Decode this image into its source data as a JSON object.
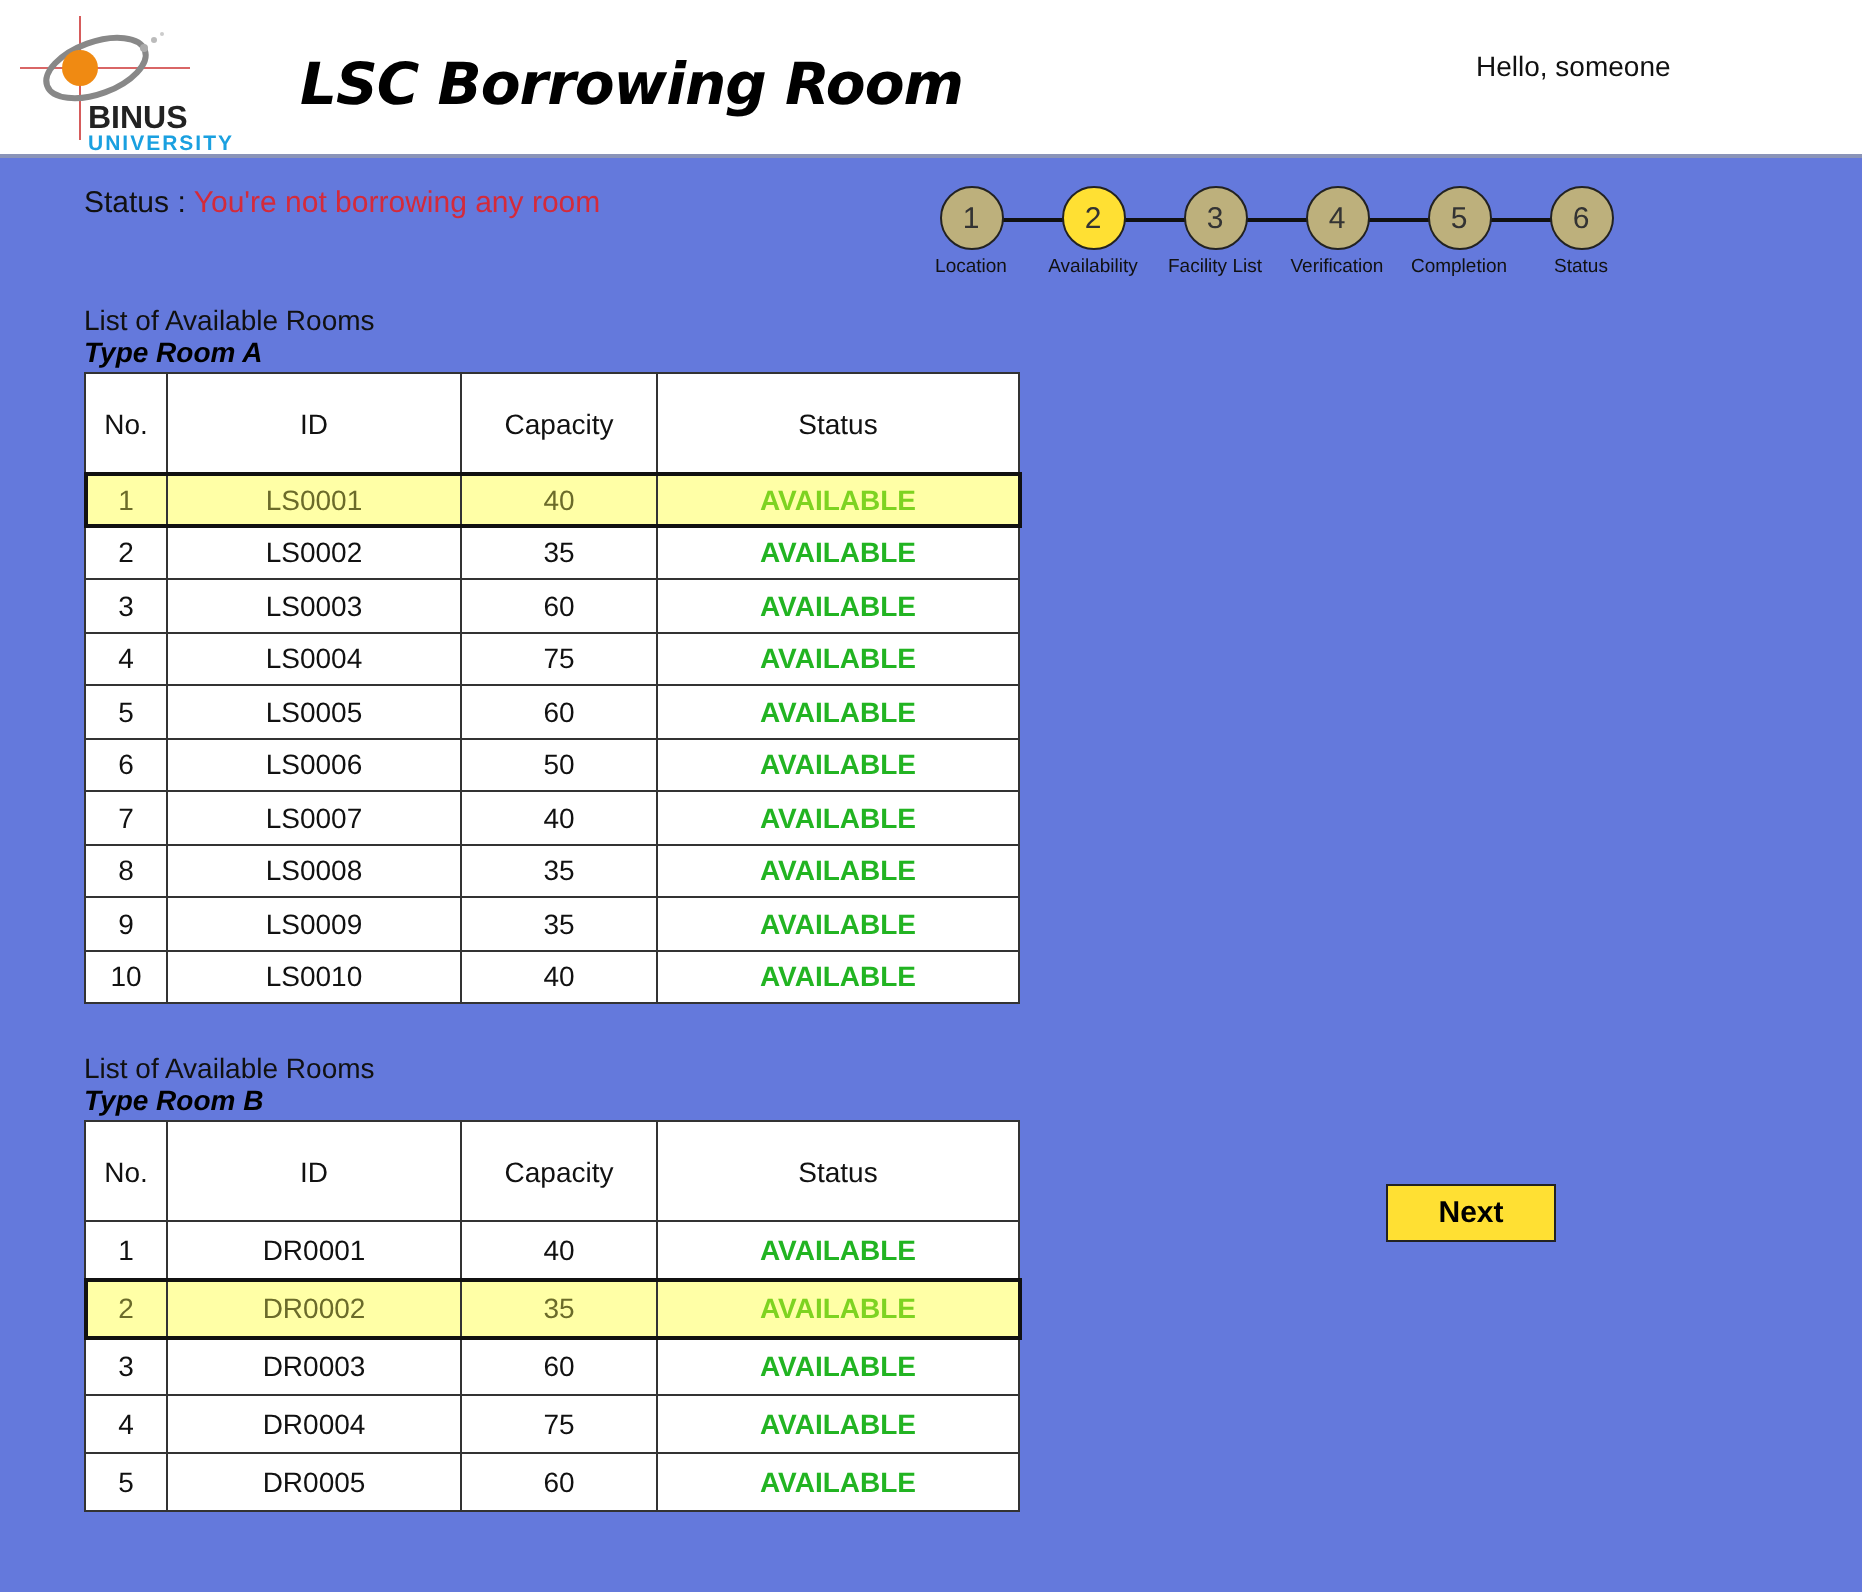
{
  "header": {
    "logo": {
      "name": "BINUS",
      "subtitle": "UNIVERSITY"
    },
    "title": "LSC Borrowing Room",
    "greeting": "Hello, someone"
  },
  "status": {
    "label": "Status :",
    "value": "You're not borrowing any room"
  },
  "steps": [
    {
      "number": "1",
      "label": "Location",
      "selected": false
    },
    {
      "number": "2",
      "label": "Availability",
      "selected": true
    },
    {
      "number": "3",
      "label": "Facility List",
      "selected": false
    },
    {
      "number": "4",
      "label": "Verification",
      "selected": false
    },
    {
      "number": "5",
      "label": "Completion",
      "selected": false
    },
    {
      "number": "6",
      "label": "Status",
      "selected": false
    }
  ],
  "tables": [
    {
      "heading": "List of Available Rooms",
      "type": "Type Room A",
      "columns": [
        "No.",
        "ID",
        "Capacity",
        "Status"
      ],
      "rows": [
        {
          "no": "1",
          "id": "LS0001",
          "capacity": "40",
          "status": "AVAILABLE",
          "selected": true
        },
        {
          "no": "2",
          "id": "LS0002",
          "capacity": "35",
          "status": "AVAILABLE",
          "selected": false
        },
        {
          "no": "3",
          "id": "LS0003",
          "capacity": "60",
          "status": "AVAILABLE",
          "selected": false
        },
        {
          "no": "4",
          "id": "LS0004",
          "capacity": "75",
          "status": "AVAILABLE",
          "selected": false
        },
        {
          "no": "5",
          "id": "LS0005",
          "capacity": "60",
          "status": "AVAILABLE",
          "selected": false
        },
        {
          "no": "6",
          "id": "LS0006",
          "capacity": "50",
          "status": "AVAILABLE",
          "selected": false
        },
        {
          "no": "7",
          "id": "LS0007",
          "capacity": "40",
          "status": "AVAILABLE",
          "selected": false
        },
        {
          "no": "8",
          "id": "LS0008",
          "capacity": "35",
          "status": "AVAILABLE",
          "selected": false
        },
        {
          "no": "9",
          "id": "LS0009",
          "capacity": "35",
          "status": "AVAILABLE",
          "selected": false
        },
        {
          "no": "10",
          "id": "LS0010",
          "capacity": "40",
          "status": "AVAILABLE",
          "selected": false
        }
      ]
    },
    {
      "heading": "List of Available Rooms",
      "type": "Type Room B",
      "columns": [
        "No.",
        "ID",
        "Capacity",
        "Status"
      ],
      "rows": [
        {
          "no": "1",
          "id": "DR0001",
          "capacity": "40",
          "status": "AVAILABLE",
          "selected": false
        },
        {
          "no": "2",
          "id": "DR0002",
          "capacity": "35",
          "status": "AVAILABLE",
          "selected": true
        },
        {
          "no": "3",
          "id": "DR0003",
          "capacity": "60",
          "status": "AVAILABLE",
          "selected": false
        },
        {
          "no": "4",
          "id": "DR0004",
          "capacity": "75",
          "status": "AVAILABLE",
          "selected": false
        },
        {
          "no": "5",
          "id": "DR0005",
          "capacity": "60",
          "status": "AVAILABLE",
          "selected": false
        }
      ]
    }
  ],
  "next_button": "Next"
}
